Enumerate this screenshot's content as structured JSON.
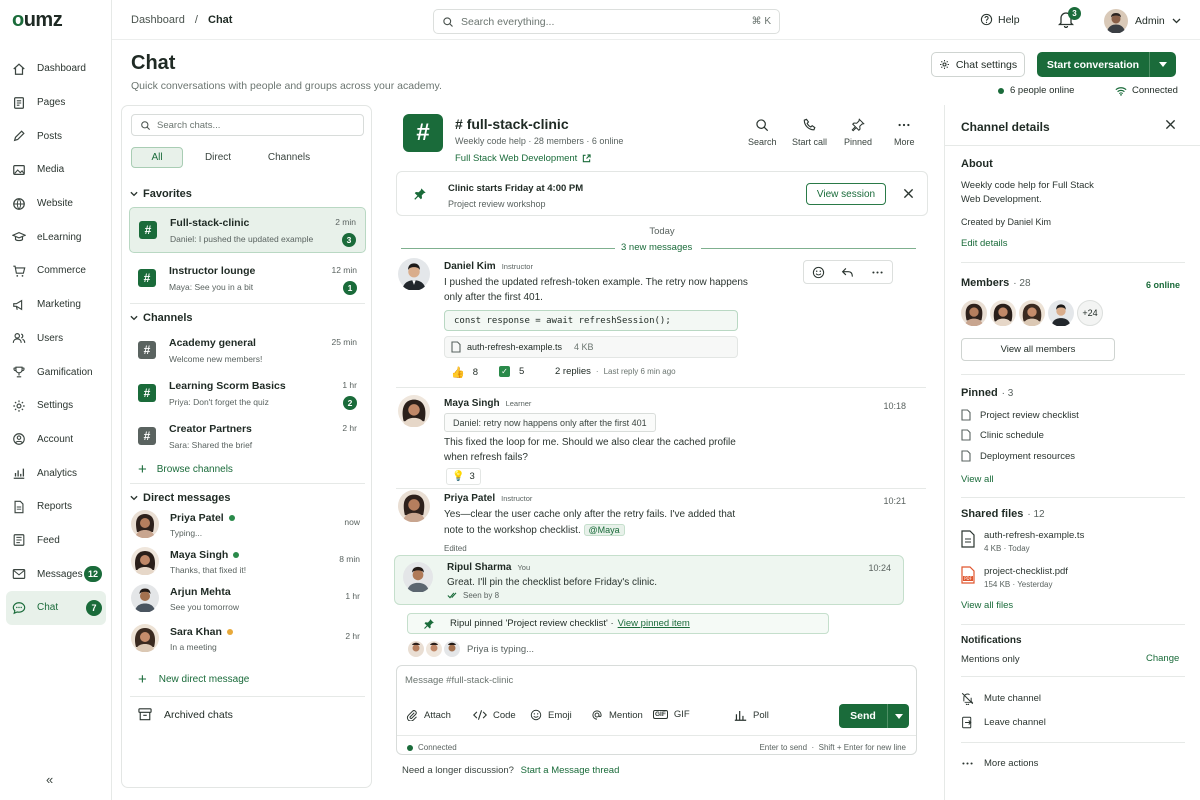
{
  "app": {
    "logo": "umz",
    "logo_o": "o"
  },
  "nav": [
    {
      "label": "Dashboard",
      "icon": "home-icon"
    },
    {
      "label": "Pages",
      "icon": "pages-icon"
    },
    {
      "label": "Posts",
      "icon": "pencil-icon"
    },
    {
      "label": "Media",
      "icon": "image-icon"
    },
    {
      "label": "Website",
      "icon": "globe-icon"
    },
    {
      "label": "eLearning",
      "icon": "graduation-cap-icon"
    },
    {
      "label": "Commerce",
      "icon": "cart-icon"
    },
    {
      "label": "Marketing",
      "icon": "megaphone-icon"
    },
    {
      "label": "Users",
      "icon": "users-icon"
    },
    {
      "label": "Gamification",
      "icon": "trophy-icon"
    },
    {
      "label": "Settings",
      "icon": "gear-icon"
    },
    {
      "label": "Account",
      "icon": "account-icon"
    },
    {
      "label": "Analytics",
      "icon": "analytics-icon"
    },
    {
      "label": "Reports",
      "icon": "report-icon"
    },
    {
      "label": "Feed",
      "icon": "feed-icon"
    },
    {
      "label": "Messages",
      "icon": "mail-icon",
      "badge": "12"
    },
    {
      "label": "Chat",
      "icon": "chat-icon",
      "badge": "7",
      "active": true
    }
  ],
  "collapse_label": "«",
  "topbar": {
    "breadcrumb_root": "Dashboard",
    "breadcrumb_sep": "/",
    "breadcrumb_current": "Chat",
    "search_placeholder": "Search everything...",
    "search_shortcut": "⌘ K",
    "help": "Help",
    "notifications_count": "3",
    "user": "Admin"
  },
  "page": {
    "title": "Chat",
    "subtitle": "Quick conversations with people and groups across your academy.",
    "settings_button": "Chat settings",
    "start_button": "Start conversation",
    "online": "6 people online",
    "connection": "Connected"
  },
  "list": {
    "search_placeholder": "Search chats...",
    "filters": [
      "All",
      "Direct",
      "Channels"
    ],
    "favorites_title": "Favorites",
    "favorites": [
      {
        "name": "Full-stack-clinic",
        "preview": "Daniel: I pushed the updated example",
        "time": "2 min",
        "badge": "3"
      },
      {
        "name": "Instructor lounge",
        "preview": "Maya: See you in a bit",
        "time": "12 min",
        "badge": "1"
      }
    ],
    "channels_title": "Channels",
    "channels": [
      {
        "name": "Academy general",
        "preview": "Welcome new members!",
        "time": "25 min",
        "badge": ""
      },
      {
        "name": "Learning Scorm Basics",
        "preview": "Priya: Don't forget the quiz",
        "time": "1 hr",
        "badge": "2"
      },
      {
        "name": "Creator Partners",
        "preview": "Sara: Shared the brief",
        "time": "2 hr",
        "badge": ""
      }
    ],
    "browse_channels": "Browse channels",
    "dm_title": "Direct messages",
    "dms": [
      {
        "name": "Priya Patel",
        "preview": "Typing...",
        "time": "now",
        "status": "#2a8a4a"
      },
      {
        "name": "Maya Singh",
        "preview": "Thanks, that fixed it!",
        "time": "8 min",
        "status": "#2a8a4a"
      },
      {
        "name": "Arjun Mehta",
        "preview": "See you tomorrow",
        "time": "1 hr",
        "status": ""
      },
      {
        "name": "Sara Khan",
        "preview": "In a meeting",
        "time": "2 hr",
        "status": "#e8a93a"
      }
    ],
    "new_dm": "New direct message",
    "archived": "Archived chats"
  },
  "channel": {
    "hash": "#",
    "title": "full-stack-clinic",
    "meta": "Weekly code help · 28 members · 6 online",
    "link": "Full Stack Web Development",
    "tools": [
      "Search",
      "Start call",
      "Pinned",
      "More"
    ],
    "pinbar_title": "Clinic starts Friday at 4:00 PM",
    "pinbar_sub": "Project review workshop",
    "pinbar_button": "View session",
    "today": "Today",
    "new_messages": "3 new messages"
  },
  "messages": {
    "m1": {
      "name": "Daniel Kim",
      "role": "Instructor",
      "line1": "I pushed the updated refresh-token example. The retry now happens",
      "line2": "only after the first 401.",
      "code": "const response = await refreshSession();",
      "file": "auth-refresh-example.ts",
      "file_size": "4 KB",
      "react1": "8",
      "react2": "5",
      "replies": "2 replies",
      "last_reply": "Last reply 6 min ago"
    },
    "m2": {
      "name": "Maya Singh",
      "role": "Learner",
      "time": "10:18",
      "quote": "Daniel: retry now happens only after the first 401",
      "line1": "This fixed the loop for me. Should we also clear the cached profile",
      "line2": "when refresh fails?",
      "react": "3"
    },
    "m3": {
      "name": "Priya Patel",
      "role": "Instructor",
      "time": "10:21",
      "line1": "Yes—clear the user cache only after the retry fails. I've added that",
      "line2": "note to the workshop checklist.",
      "mention": "@Maya",
      "edited": "Edited"
    },
    "m4": {
      "name": "Ripul Sharma",
      "role": "You",
      "time": "10:24",
      "text": "Great. I'll pin the checklist before Friday's clinic.",
      "seen": "Seen by 8"
    },
    "system": {
      "text": "Ripul pinned 'Project review checklist' ·",
      "link": "View pinned item"
    },
    "typing": "Priya is typing..."
  },
  "composer": {
    "placeholder": "Message #full-stack-clinic",
    "tools": [
      "Attach",
      "Code",
      "Emoji",
      "Mention",
      "GIF",
      "Poll"
    ],
    "send": "Send",
    "status": "Connected",
    "hint": "Enter to send  ·  Shift + Enter for new line",
    "longer": "Need a longer discussion?",
    "thread_link": "Start a Message thread"
  },
  "details": {
    "title": "Channel details",
    "about_title": "About",
    "about_line1": "Weekly code help for Full Stack",
    "about_line2": "Web Development.",
    "created_by": "Created by Daniel Kim",
    "edit": "Edit details",
    "members_title": "Members",
    "members_count": "· 28",
    "members_online": "6 online",
    "members_more": "+24",
    "view_members": "View all members",
    "pinned_title": "Pinned",
    "pinned_count": "· 3",
    "pinned": [
      "Project review checklist",
      "Clinic schedule",
      "Deployment resources"
    ],
    "view_all": "View all",
    "files_title": "Shared files",
    "files_count": "· 12",
    "files": [
      {
        "name": "auth-refresh-example.ts",
        "meta": "4 KB · Today"
      },
      {
        "name": "project-checklist.pdf",
        "meta": "154 KB · Yesterday"
      }
    ],
    "view_files": "View all files",
    "notif_title": "Notifications",
    "notif_value": "Mentions only",
    "change": "Change",
    "mute": "Mute channel",
    "leave": "Leave channel",
    "more": "More actions"
  },
  "colors": {
    "accent": "#1a6b3a",
    "accent_light": "#e8f1ea"
  }
}
